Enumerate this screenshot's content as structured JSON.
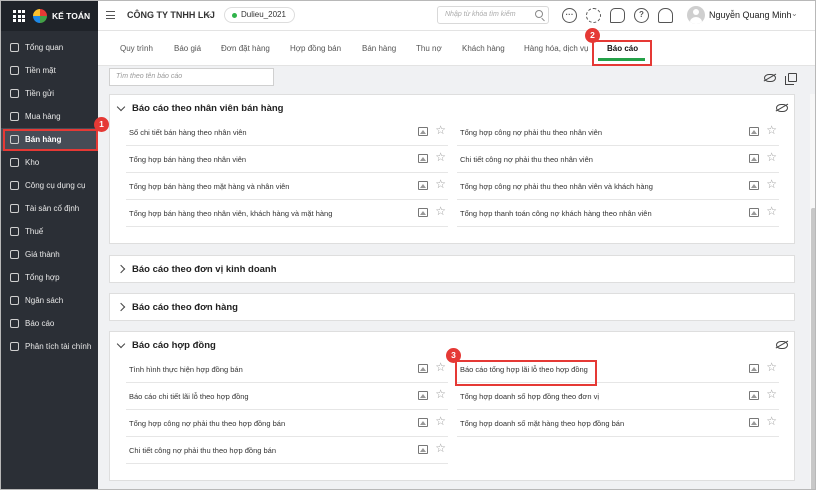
{
  "app": {
    "brand": "KẾ TOÁN",
    "company": "CÔNG TY TNHH LKJ",
    "database": "Dulieu_2021",
    "search_placeholder": "Nhập từ khóa tìm kiếm",
    "user": "Nguyễn Quang Minh"
  },
  "sidebar": {
    "items": [
      {
        "label": "Tổng quan",
        "icon": "dashboard-icon"
      },
      {
        "label": "Tiền mặt",
        "icon": "cash-icon"
      },
      {
        "label": "Tiền gửi",
        "icon": "bank-icon"
      },
      {
        "label": "Mua hàng",
        "icon": "purchase-icon"
      },
      {
        "label": "Bán hàng",
        "icon": "cart-icon"
      },
      {
        "label": "Kho",
        "icon": "warehouse-icon"
      },
      {
        "label": "Công cụ dụng cụ",
        "icon": "tools-icon"
      },
      {
        "label": "Tài sản cố định",
        "icon": "asset-icon"
      },
      {
        "label": "Thuế",
        "icon": "tax-icon"
      },
      {
        "label": "Giá thành",
        "icon": "cost-icon"
      },
      {
        "label": "Tổng hợp",
        "icon": "summary-icon"
      },
      {
        "label": "Ngân sách",
        "icon": "budget-icon"
      },
      {
        "label": "Báo cáo",
        "icon": "report-icon"
      },
      {
        "label": "Phân tích tài chính",
        "icon": "analytics-icon"
      }
    ],
    "active": "Bán hàng"
  },
  "tabs": [
    "Quy trình",
    "Báo giá",
    "Đơn đặt hàng",
    "Hợp đồng bán",
    "Bán hàng",
    "Thu nợ",
    "Khách hàng",
    "Hàng hóa, dịch vụ",
    "Báo cáo"
  ],
  "active_tab": "Báo cáo",
  "filter_placeholder": "Tìm theo tên báo cáo",
  "badges": [
    "1",
    "2",
    "3"
  ],
  "sections": [
    {
      "title": "Báo cáo theo nhân viên bán hàng",
      "expanded": true,
      "left": [
        "Sổ chi tiết bán hàng theo nhân viên",
        "Tổng hợp bán hàng theo nhân viên",
        "Tổng hợp bán hàng theo mặt hàng và nhân viên",
        "Tổng hợp bán hàng theo nhân viên, khách hàng và mặt hàng"
      ],
      "right": [
        "Tổng hợp công nợ phải thu theo nhân viên",
        "Chi tiết công nợ phải thu theo nhân viên",
        "Tổng hợp công nợ phải thu theo nhân viên và khách hàng",
        "Tổng hợp thanh toán công nợ khách hàng theo nhân viên"
      ]
    },
    {
      "title": "Báo cáo theo đơn vị kinh doanh",
      "expanded": false
    },
    {
      "title": "Báo cáo theo đơn hàng",
      "expanded": false
    },
    {
      "title": "Báo cáo hợp đồng",
      "expanded": true,
      "left": [
        "Tình hình thực hiện hợp đồng bán",
        "Báo cáo chi tiết lãi lỗ theo hợp đồng",
        "Tổng hợp công nợ phải thu theo hợp đồng bán",
        "Chi tiết công nợ phải thu theo hợp đồng bán"
      ],
      "right": [
        "Báo cáo tổng hợp lãi lỗ theo hợp đồng",
        "Tổng hợp doanh số hợp đồng theo đơn vị",
        "Tổng hợp doanh số mặt hàng theo hợp đồng bán"
      ]
    }
  ]
}
